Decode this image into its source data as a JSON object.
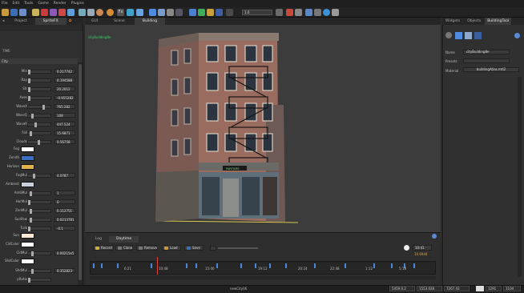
{
  "menu": [
    "File",
    "Edit",
    "Tools",
    "Game",
    "Render",
    "Plugins"
  ],
  "toolbar": {
    "zoom_value": "1.0"
  },
  "left_tabs": [
    "Project",
    "SpriteFX"
  ],
  "left_tab_icon": "gear-icon",
  "left_panel": {
    "section_header": "TIME",
    "group_header": "City",
    "rows": [
      {
        "label": "Min",
        "value": "0.217742"
      },
      {
        "label": "Ray",
        "value": "0.194588"
      },
      {
        "label": "Str",
        "value": "20.2012"
      },
      {
        "label": "Axes",
        "value": "-0.955282"
      },
      {
        "label": "WaveX",
        "value": "765.282"
      },
      {
        "label": "WaveQ",
        "value": "108"
      },
      {
        "label": "WaveR",
        "value": "447.524"
      },
      {
        "label": "Fall",
        "value": "15.6871"
      },
      {
        "label": "Clouds",
        "value": "0.56758"
      }
    ],
    "colors": [
      {
        "label": "Fog",
        "color": "#ffffff"
      },
      {
        "label": "Zenith",
        "color": "#3a6fc4"
      },
      {
        "label": "Horizon",
        "color": "#e2b24a"
      }
    ],
    "rows2": [
      {
        "label": "FogMul",
        "value": "4.0787"
      }
    ],
    "ambient_label": "Ambient",
    "ambient_color": "#c8d0dc",
    "rows3": [
      {
        "label": "AmbMul",
        "value": "1"
      },
      {
        "label": "HorMul",
        "value": "0"
      },
      {
        "label": "ZenMul",
        "value": "0.112751"
      },
      {
        "label": "SunPow",
        "value": "0.0213781"
      },
      {
        "label": "Turb",
        "value": "-0.1"
      }
    ],
    "colors2": [
      {
        "label": "Sun",
        "color": "#ffe9d4"
      },
      {
        "label": "CldColor",
        "color": "#ffffff"
      }
    ],
    "rows4": [
      {
        "label": "CldMul",
        "value": "0.00215e5"
      }
    ],
    "colors3": [
      {
        "label": "ShdColor",
        "color": "#ffffff"
      }
    ],
    "rows5": [
      {
        "label": "ShdMul",
        "value": "0.352823"
      },
      {
        "label": "pRatio",
        "value": ""
      }
    ]
  },
  "center_tabs": [
    "GUI",
    "Scene",
    "Building"
  ],
  "viewport": {
    "object_label": "cityBuilding8e",
    "sign_text": "PARFUMS"
  },
  "bottom": {
    "tabs": [
      "Log",
      "Daytime"
    ],
    "buttons": [
      "Record",
      "Clone",
      "Remove",
      "Load",
      "Save"
    ],
    "time_main": "10:41",
    "time_sub": "10.6944",
    "ticks": [
      "6:21",
      "10:48",
      "15:00",
      "19:12",
      "20:24",
      "22:48",
      "1:12",
      "5:18"
    ]
  },
  "status": {
    "scene_name": "newCity06",
    "coords": [
      "5459.0.2",
      "1553.028",
      "7267.43"
    ],
    "extra": [
      "1291",
      "1104"
    ]
  },
  "right_tabs": [
    "Widgets",
    "Objects",
    "BuildingTool"
  ],
  "right_panel": {
    "name_label": "Name",
    "name_value": "cityBuilding8e",
    "presets_label": "Presets",
    "presets_value": "",
    "material_label": "Material",
    "material_value": "buildingAtlas.mtl2"
  },
  "accent": "#3ad16b"
}
